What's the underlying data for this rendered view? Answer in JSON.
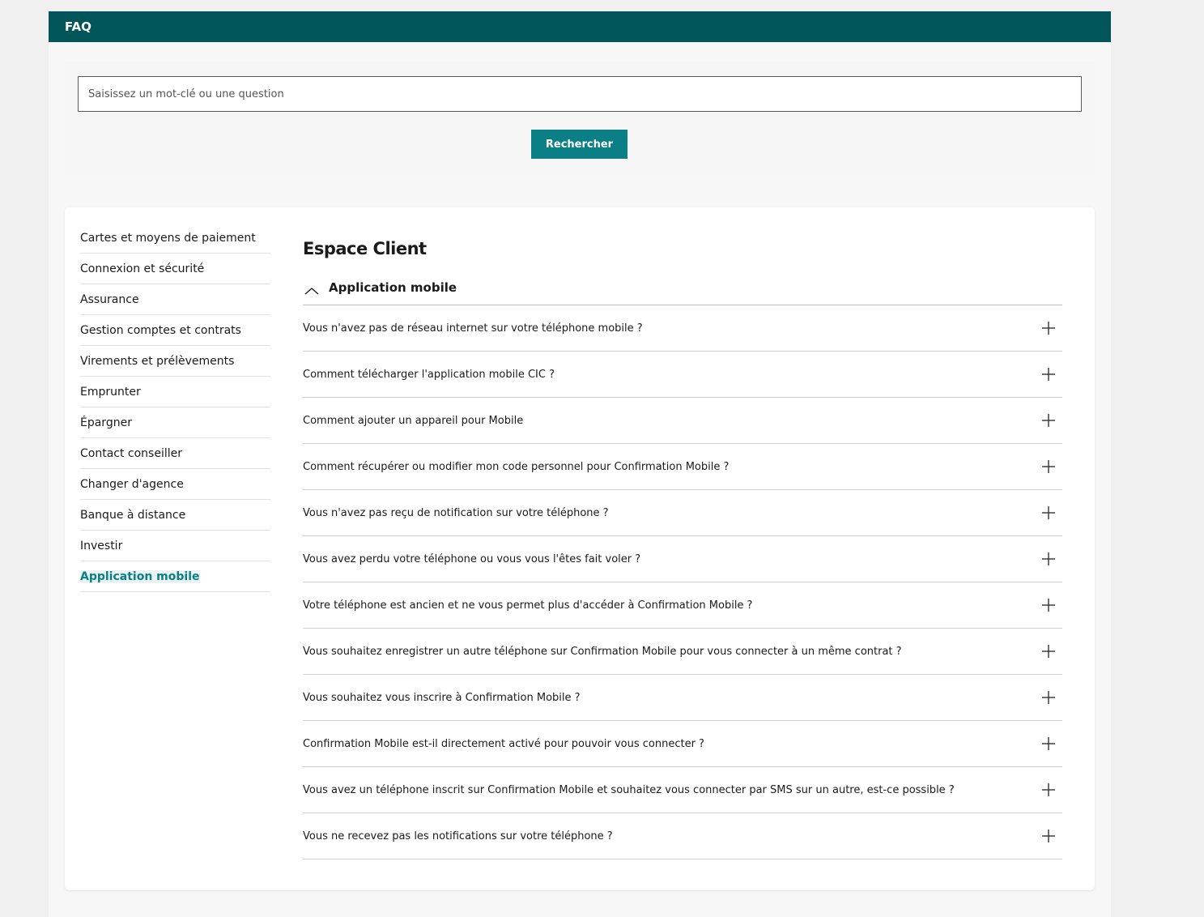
{
  "header": {
    "title": "FAQ"
  },
  "search": {
    "placeholder": "Saisissez un mot-clé ou une question",
    "button_label": "Rechercher"
  },
  "sidebar": {
    "items": [
      {
        "label": "Cartes et moyens de paiement"
      },
      {
        "label": "Connexion et sécurité"
      },
      {
        "label": "Assurance"
      },
      {
        "label": "Gestion comptes et contrats"
      },
      {
        "label": "Virements et prélèvements"
      },
      {
        "label": "Emprunter"
      },
      {
        "label": "Épargner"
      },
      {
        "label": "Contact conseiller"
      },
      {
        "label": "Changer d'agence"
      },
      {
        "label": "Banque à distance"
      },
      {
        "label": "Investir"
      },
      {
        "label": "Application mobile",
        "active": true
      }
    ]
  },
  "main": {
    "title": "Espace Client",
    "group": {
      "label": "Application mobile",
      "expanded": true,
      "questions": [
        "Vous n'avez pas de réseau internet sur votre téléphone mobile ?",
        "Comment télécharger l'application mobile CIC ?",
        "Comment ajouter un appareil pour Mobile",
        "Comment récupérer ou modifier mon code personnel pour Confirmation Mobile ?",
        "Vous n'avez pas reçu de notification sur votre téléphone ?",
        "Vous avez perdu votre téléphone ou vous vous l'êtes fait voler ?",
        "Votre téléphone est ancien et ne vous permet plus d'accéder à Confirmation Mobile ?",
        "Vous souhaitez enregistrer un autre téléphone sur Confirmation Mobile pour vous connecter à un même contrat ?",
        "Vous souhaitez vous inscrire à Confirmation Mobile ?",
        "Confirmation Mobile est-il directement activé pour pouvoir vous connecter ?",
        "Vous avez un téléphone inscrit sur Confirmation Mobile et souhaitez vous connecter par SMS sur un autre, est-ce possible ?",
        "Vous ne recevez pas les notifications sur votre téléphone ?"
      ]
    }
  },
  "colors": {
    "header_bg": "#02565a",
    "accent": "#0a7f86",
    "page_bg": "#f0f0f0"
  },
  "icons": {
    "collapse": "chevron-up-icon",
    "expand": "plus-icon"
  }
}
